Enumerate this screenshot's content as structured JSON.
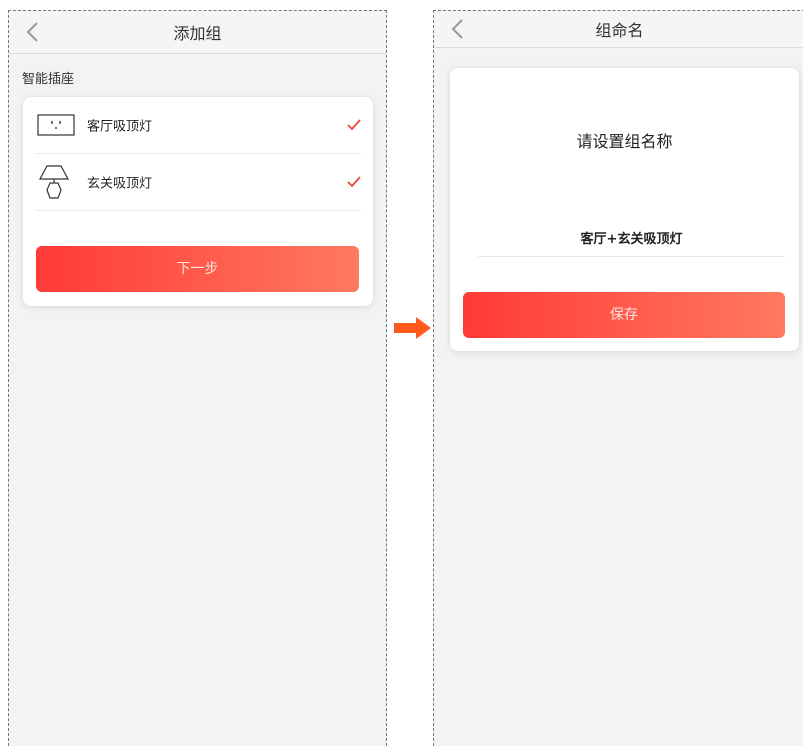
{
  "left_screen": {
    "title": "添加组",
    "section_label": "智能插座",
    "devices": [
      {
        "name": "客厅吸顶灯",
        "icon": "socket-icon",
        "checked": true
      },
      {
        "name": "玄关吸顶灯",
        "icon": "lamp-icon",
        "checked": true
      }
    ],
    "next_label": "下一步"
  },
  "right_screen": {
    "title": "组命名",
    "dialog_title": "请设置组名称",
    "group_name": "客厅+玄关吸顶灯",
    "save_label": "保存"
  },
  "icons": {
    "back": "chevron-left-icon",
    "check": "check-icon",
    "flow": "arrow-right-icon"
  },
  "colors": {
    "accent_start": "#ff3a37",
    "accent_end": "#ff7a5f",
    "check": "#e5473c",
    "flow_arrow": "#ff5a1e"
  }
}
